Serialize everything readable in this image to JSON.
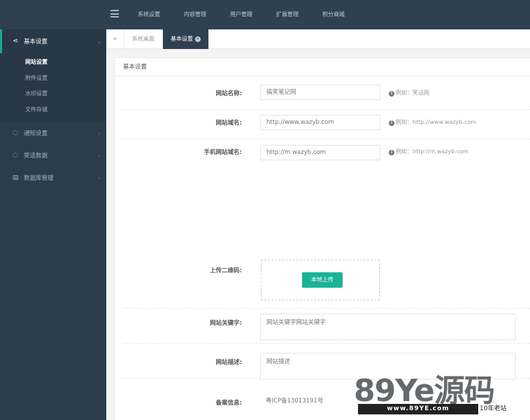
{
  "topnav": {
    "items": [
      "系统设置",
      "内容管理",
      "用户管理",
      "扩展管理",
      "积分商城"
    ]
  },
  "sidebar": {
    "groups": [
      {
        "label": "基本设置",
        "icon": "share-icon",
        "items": [
          "网站设置",
          "附件设置",
          "水印设置",
          "文件存储"
        ]
      },
      {
        "label": "通知设置",
        "icon": "chat-icon"
      },
      {
        "label": "笑话数据",
        "icon": "comment-icon"
      },
      {
        "label": "数据库管理",
        "icon": "database-icon"
      }
    ]
  },
  "tabs": {
    "items": [
      "系统桌面",
      "基本设置"
    ],
    "active_index": 1
  },
  "panel": {
    "title": "基本设置"
  },
  "form": {
    "site_name": {
      "label": "网站名称:",
      "value": "搞笑笔记网",
      "hint": "例如：笑话网"
    },
    "site_domain": {
      "label": "网站域名:",
      "value": "http://www.wazyb.com",
      "hint": "例如：http://www.wazyb.com"
    },
    "mobile_domain": {
      "label": "手机网站域名:",
      "value": "http://m.wazyb.com",
      "hint": "例如：http://m.wazyb.com"
    },
    "qrcode": {
      "label": "上传二维码:",
      "button": "本地上传"
    },
    "keywords": {
      "label": "网站关键字:",
      "value": "网站关键字网站关键字"
    },
    "description": {
      "label": "网站描述:",
      "value": "网站描述"
    },
    "icp": {
      "label": "备案信息:",
      "value": "粤ICP备13013191号"
    }
  },
  "watermark": {
    "brand": "89Ye源码",
    "url": "www.89YE.com",
    "tag": "10年老站"
  },
  "colors": {
    "nav_bg": "#2f4050",
    "sidebar_bg": "#2b3c4d",
    "accent": "#1ab394"
  }
}
